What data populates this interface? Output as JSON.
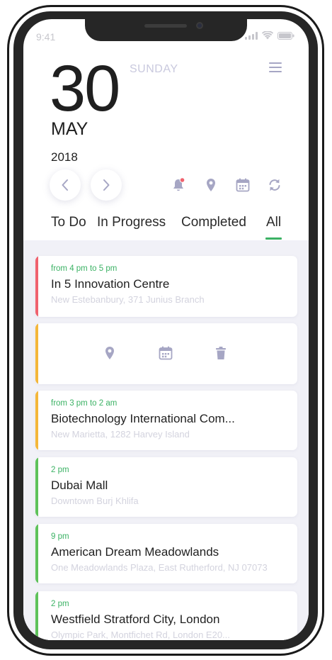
{
  "status_bar": {
    "time": "9:41"
  },
  "header": {
    "day": "30",
    "weekday": "SUNDAY",
    "month": "MAY",
    "year": "2018"
  },
  "toolbar_icons": [
    "notification-bell-icon",
    "location-pin-icon",
    "calendar-icon",
    "sync-icon"
  ],
  "tabs": [
    {
      "label": "To Do"
    },
    {
      "label": "In Progress"
    },
    {
      "label": "Completed"
    },
    {
      "label": "All",
      "active": true
    }
  ],
  "events": [
    {
      "time": "from 4 pm to 5 pm",
      "title": "In 5 Innovation Centre",
      "address": "New Estebanbury, 371 Junius Branch",
      "bar_color": "#f0626e"
    },
    {
      "actions": [
        "location-pin-icon",
        "calendar-icon",
        "trash-icon"
      ],
      "bar_color": "#f4b73a"
    },
    {
      "time": "from 3 pm to 2 am",
      "title": "Biotechnology International  Com...",
      "address": "New Marietta, 1282 Harvey Island",
      "bar_color": "#f4b73a"
    },
    {
      "time": "2 pm",
      "title": "Dubai Mall",
      "address": "Downtown Burj Khlifa",
      "bar_color": "#5ec25a"
    },
    {
      "time": "9 pm",
      "title": "American Dream Meadowlands",
      "address": "One Meadowlands Plaza, East Rutherford, NJ 07073",
      "bar_color": "#5ec25a"
    },
    {
      "time": "2 pm",
      "title": "Westfield Stratford City, London",
      "address": "Olympic Park, Montfichet Rd, London E20...",
      "bar_color": "#5ec25a"
    }
  ],
  "colors": {
    "accent_green": "#3bb264",
    "icon_muted": "#a6a6c4",
    "notification_dot": "#f0626e",
    "list_background": "#f1f1f7"
  }
}
